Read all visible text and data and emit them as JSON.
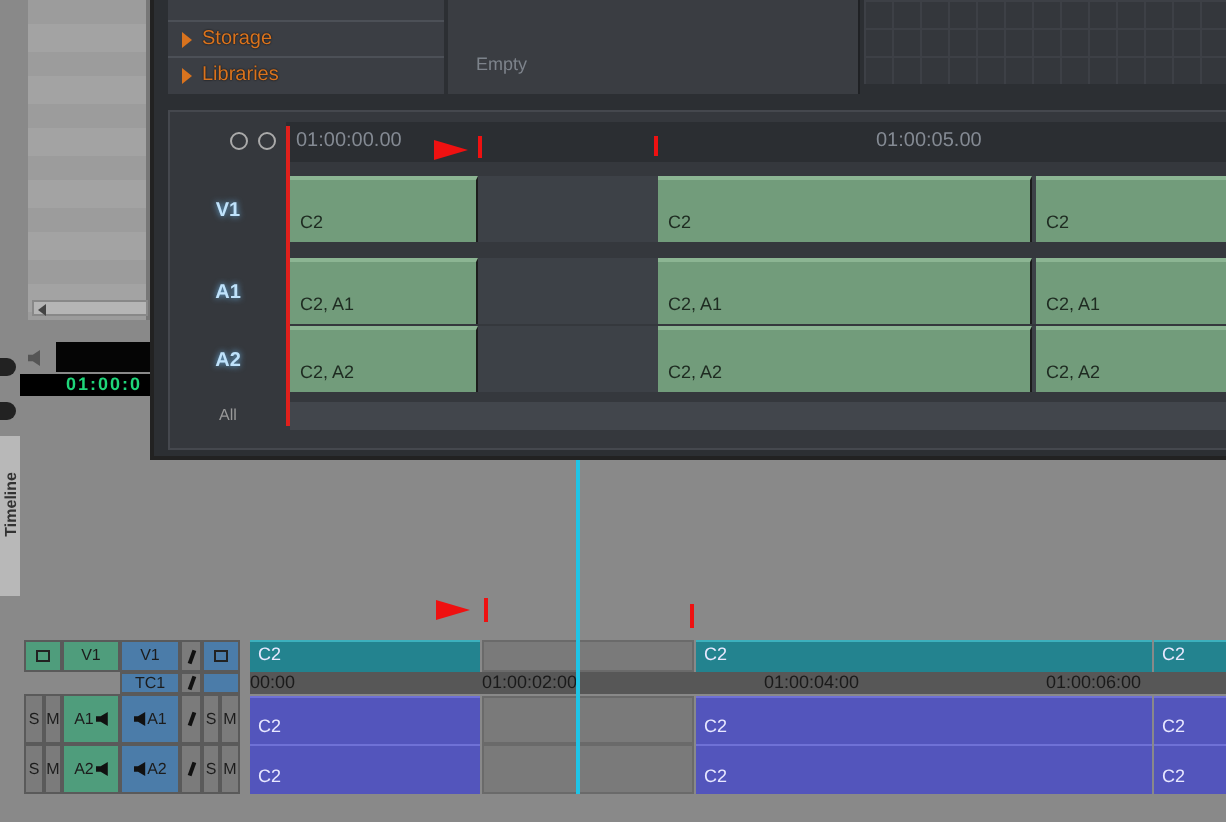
{
  "browser": {
    "items": [
      {
        "label": "Storage",
        "expanded": false
      },
      {
        "label": "Libraries",
        "expanded": false
      }
    ]
  },
  "bin_panel": {
    "status": "Empty"
  },
  "source_monitor": {
    "timecode": "01:00:0"
  },
  "side_tab": {
    "label": "Timeline"
  },
  "trim_window": {
    "ruler": [
      "01:00:00.00",
      "01:00:05.00"
    ],
    "tracks": [
      {
        "name": "V1",
        "clips": [
          "C2",
          "C2",
          "C2"
        ]
      },
      {
        "name": "A1",
        "clips": [
          "C2, A1",
          "C2, A1",
          "C2, A1"
        ]
      },
      {
        "name": "A2",
        "clips": [
          "C2, A2",
          "C2, A2",
          "C2, A2"
        ]
      }
    ],
    "all_label": "All"
  },
  "timeline": {
    "track_headers": [
      {
        "kind": "video",
        "source": "V1",
        "record": "V1"
      },
      {
        "kind": "timecode",
        "record": "TC1"
      },
      {
        "kind": "audio",
        "left_buttons": [
          "S",
          "M"
        ],
        "source": "A1",
        "record": "A1",
        "right_buttons": [
          "S",
          "M"
        ]
      },
      {
        "kind": "audio",
        "left_buttons": [
          "S",
          "M"
        ],
        "source": "A2",
        "record": "A2",
        "right_buttons": [
          "S",
          "M"
        ]
      }
    ],
    "ruler": [
      "00:00",
      "01:00:02:00",
      "01:00:04:00",
      "01:00:06:00"
    ],
    "tracks": [
      {
        "kind": "video",
        "clips": [
          {
            "kind": "clip",
            "label": "C2"
          },
          {
            "kind": "filler"
          },
          {
            "kind": "clip",
            "label": "C2"
          },
          {
            "kind": "clip",
            "label": "C2"
          }
        ]
      },
      {
        "kind": "audio",
        "clips": [
          {
            "kind": "clip",
            "label": "C2"
          },
          {
            "kind": "filler"
          },
          {
            "kind": "clip",
            "label": "C2"
          },
          {
            "kind": "clip",
            "label": "C2"
          }
        ]
      },
      {
        "kind": "audio",
        "clips": [
          {
            "kind": "clip",
            "label": "C2"
          },
          {
            "kind": "filler"
          },
          {
            "kind": "clip",
            "label": "C2"
          },
          {
            "kind": "clip",
            "label": "C2"
          }
        ]
      }
    ]
  }
}
